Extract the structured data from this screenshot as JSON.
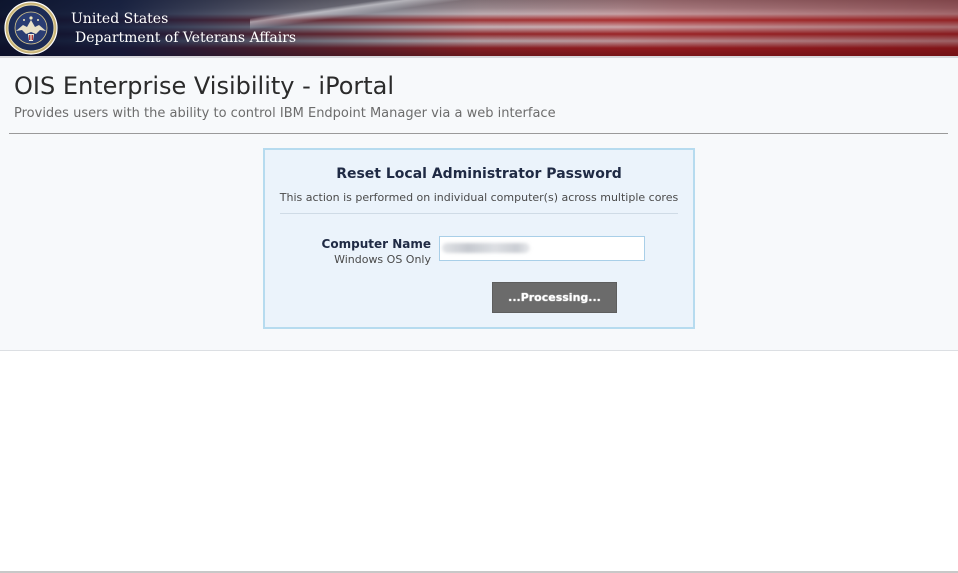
{
  "banner": {
    "agency_line1": "United States",
    "agency_line2": "Department of Veterans Affairs",
    "seal_icon": "va-seal-icon"
  },
  "header": {
    "title": "OIS Enterprise Visibility - iPortal",
    "subtitle": "Provides users with the ability to control IBM Endpoint Manager via a web interface"
  },
  "panel": {
    "title": "Reset Local Administrator Password",
    "description": "This action is performed on individual computer(s) across multiple cores",
    "field_label": "Computer Name",
    "field_hint": "Windows OS Only",
    "button_label": "...Processing..."
  },
  "colors": {
    "panel_background": "#ebf3fb",
    "panel_border": "#b6dbef",
    "button_background": "#6b6b6b",
    "banner_navy": "#0e1838",
    "banner_red": "#9a2a2c"
  }
}
